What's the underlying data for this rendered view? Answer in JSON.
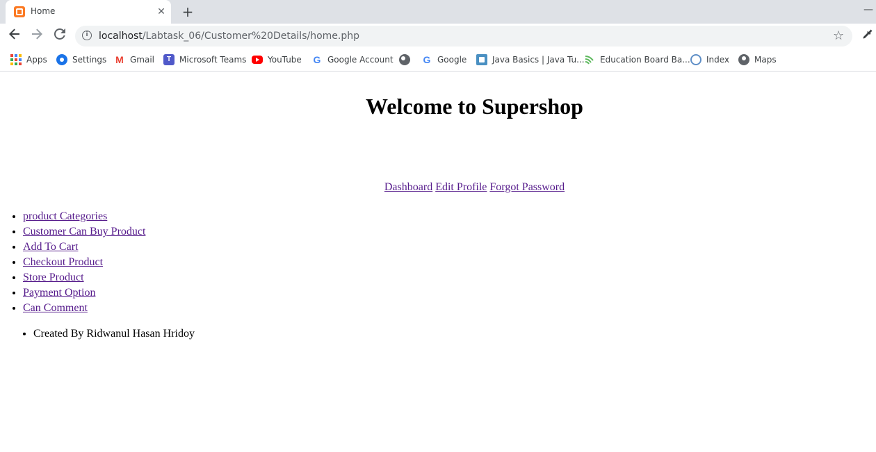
{
  "browser": {
    "tab": {
      "title": "Home",
      "close": "✕"
    },
    "new_tab": "+",
    "minimize": "—",
    "url": {
      "host": "localhost",
      "path": "/Labtask_06/Customer%20Details/home.php"
    },
    "bookmarks": [
      {
        "label": "Apps",
        "icon": "apps-icon"
      },
      {
        "label": "Settings",
        "icon": "settings-icon"
      },
      {
        "label": "Gmail",
        "icon": "gmail-icon"
      },
      {
        "label": "Microsoft Teams",
        "icon": "teams-icon"
      },
      {
        "label": "YouTube",
        "icon": "youtube-icon"
      },
      {
        "label": "Google Account",
        "icon": "google-icon"
      },
      {
        "label": "",
        "icon": "globe-icon"
      },
      {
        "label": "Google",
        "icon": "google-icon"
      },
      {
        "label": "Java Basics | Java Tu...",
        "icon": "java-icon"
      },
      {
        "label": "Education Board Ba...",
        "icon": "education-icon"
      },
      {
        "label": "Index",
        "icon": "index-icon"
      },
      {
        "label": "Maps",
        "icon": "maps-icon"
      }
    ]
  },
  "page": {
    "heading": "Welcome to Supershop",
    "top_links": [
      "Dashboard",
      "Edit Profile",
      "Forgot Password"
    ],
    "menu": [
      "product Categories",
      "Customer Can Buy Product",
      "Add To Cart",
      "Checkout Product",
      "Store Product",
      "Payment Option",
      "Can Comment"
    ],
    "footer": "Created By Ridwanul Hasan Hridoy"
  },
  "colors": {
    "visited_link": "#551a8b",
    "tabstrip": "#dee1e6",
    "omnibox": "#f1f3f4"
  }
}
